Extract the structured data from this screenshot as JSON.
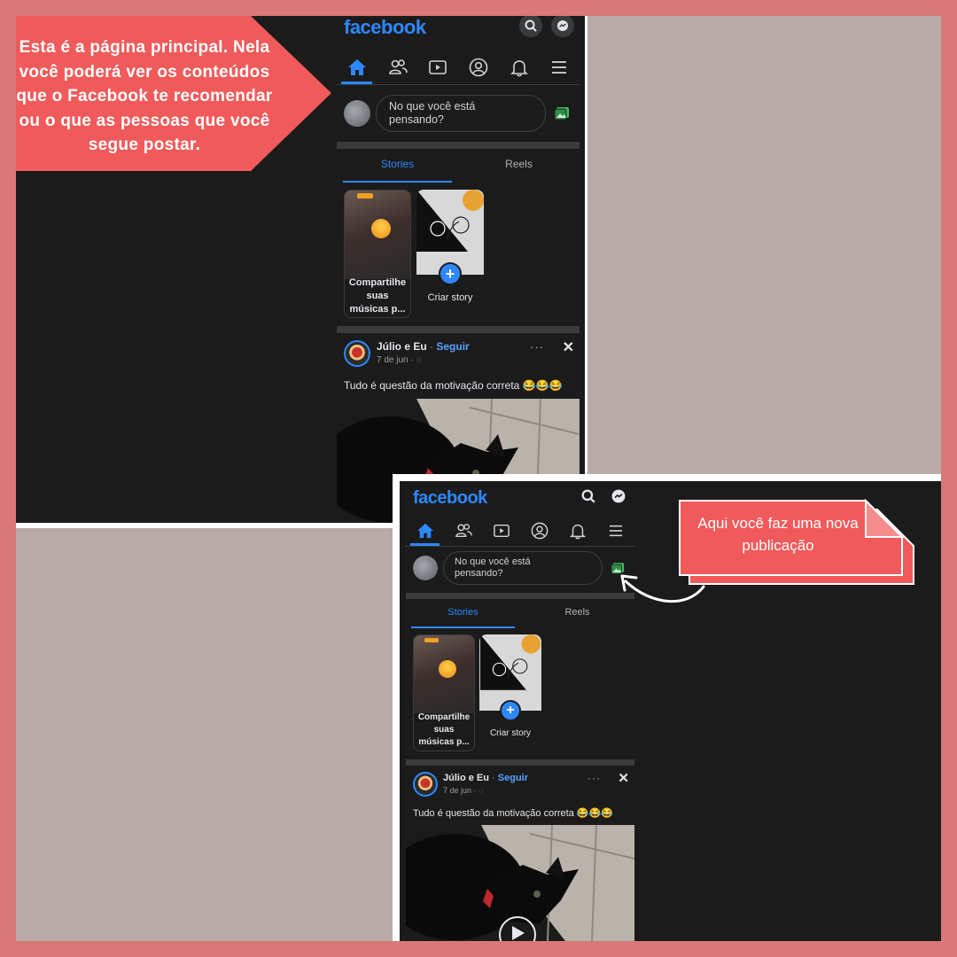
{
  "colors": {
    "frame": "#d97878",
    "panel_gray": "#b9aba7",
    "app_dark": "#1b1b1b",
    "fb_blue": "#2d88ff",
    "callout_red": "#f05a5a"
  },
  "callouts": {
    "main_page": "Esta é a página principal. Nela você poderá ver os conteúdos que o Facebook te recomendar ou o que as pessoas que você segue postar.",
    "new_post": "Aqui você faz uma nova publicação"
  },
  "fb": {
    "logo": "facebook",
    "top_icons": [
      "search-icon",
      "messenger-icon"
    ],
    "nav_icons": [
      "home-icon",
      "friends-icon",
      "watch-icon",
      "profile-icon",
      "bell-icon",
      "menu-icon"
    ],
    "composer_placeholder_line1": "No que você está",
    "composer_placeholder_line2": "pensando?",
    "tabs": {
      "stories": "Stories",
      "reels": "Reels"
    },
    "stories": {
      "first_line1": "Compartilhe",
      "first_line2": "suas",
      "first_line3": "músicas p...",
      "create": "Criar story"
    },
    "post": {
      "author": "Júlio e Eu",
      "separator": "·",
      "follow": "Seguir",
      "date": "7 de jun ·",
      "more": "···",
      "close": "✕",
      "text": "Tudo é questão da motivação correta 😂😂😂"
    }
  }
}
